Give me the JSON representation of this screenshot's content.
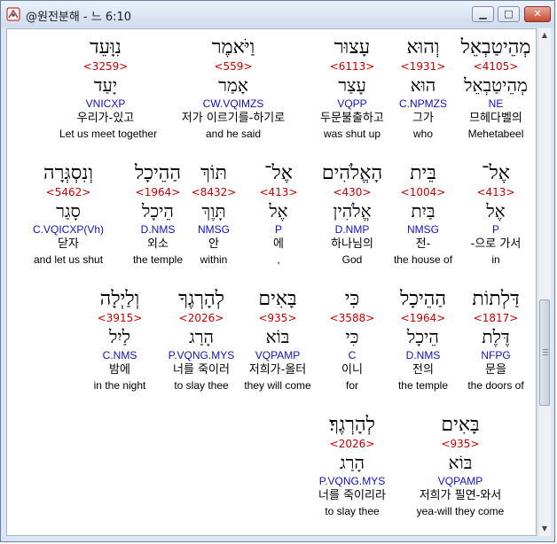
{
  "window": {
    "title": "@원전분해 - 느 6:10",
    "buttons": {
      "minimize": "▁",
      "maximize": "□",
      "close": "✕"
    }
  },
  "rows": [
    [
      {
        "hebrew": "מְהֵיטַבְאֵל",
        "number": "<4105>",
        "lexeme": "מְהֵיטַבְאֵל",
        "parse": "NE",
        "korean": "므헤다벨의",
        "english": "Mehetabeel"
      },
      {
        "hebrew": "וְהוּא",
        "number": "<1931>",
        "lexeme": "הוּא",
        "parse": "C.NPMZS",
        "korean": "그가",
        "english": "who"
      },
      {
        "hebrew": "עָצוּר",
        "number": "<6113>",
        "lexeme": "עָצַר",
        "parse": "VQPP",
        "korean": "두문불출하고",
        "english": "was shut up"
      },
      {
        "hebrew": "וַיֹּאמֶר",
        "number": "<559>",
        "lexeme": "אָמַר",
        "parse": "CW.VQIMZS",
        "korean": "저가 이르기를-하기로",
        "english": "and he said"
      },
      {
        "hebrew": "נִוָּעֵד",
        "number": "<3259>",
        "lexeme": "יָעַד",
        "parse": "VNICXP",
        "korean": "우리가-있고",
        "english": "Let us meet together"
      }
    ],
    [
      {
        "hebrew": "אֶל־",
        "number": "<413>",
        "lexeme": "אֶל",
        "parse": "P",
        "korean": "-으로 가서",
        "english": "in"
      },
      {
        "hebrew": "בֵּית",
        "number": "<1004>",
        "lexeme": "בַּיִת",
        "parse": "NMSG",
        "korean": "전-",
        "english": "the house of"
      },
      {
        "hebrew": "הָאֱלֹהִים",
        "number": "<430>",
        "lexeme": "אֱלֹהִין",
        "parse": "D.NMP",
        "korean": "하나님의",
        "english": "God"
      },
      {
        "hebrew": "אֶל־",
        "number": "<413>",
        "lexeme": "אֶל",
        "parse": "P",
        "korean": "에",
        "english": ","
      },
      {
        "hebrew": "תּוֹךְ",
        "number": "<8432>",
        "lexeme": "תָּוֶךְ",
        "parse": "NMSG",
        "korean": "안",
        "english": "within"
      },
      {
        "hebrew": "הַהֵיכָל",
        "number": "<1964>",
        "lexeme": "הֵיכָל",
        "parse": "D.NMS",
        "korean": "외소",
        "english": "the temple"
      },
      {
        "hebrew": "וְנִסְגְּרָה",
        "number": "<5462>",
        "lexeme": "סָגַר",
        "parse": "C.VQICXP(Vh)",
        "korean": "닫자",
        "english": "and let us shut"
      }
    ],
    [
      {
        "hebrew": "דַּלְתוֹת",
        "number": "<1817>",
        "lexeme": "דֶּלֶת",
        "parse": "NFPG",
        "korean": "문을",
        "english": "the doors of"
      },
      {
        "hebrew": "הַהֵיכָל",
        "number": "<1964>",
        "lexeme": "הֵיכָל",
        "parse": "D.NMS",
        "korean": "전의",
        "english": "the temple"
      },
      {
        "hebrew": "כִּי",
        "number": "<3588>",
        "lexeme": "כִּי",
        "parse": "C",
        "korean": "이니",
        "english": "for"
      },
      {
        "hebrew": "בָּאִים",
        "number": "<935>",
        "lexeme": "בּוֹא",
        "parse": "VQPAMP",
        "korean": "저희가-올터",
        "english": "they will come"
      },
      {
        "hebrew": "לְהָרְגֶךָ",
        "number": "<2026>",
        "lexeme": "הָרַג",
        "parse": "P.VQNG.MYS",
        "korean": "너를 죽이러",
        "english": "to slay thee"
      },
      {
        "hebrew": "וְלַיְלָה",
        "number": "<3915>",
        "lexeme": "לַיִל",
        "parse": "C.NMS",
        "korean": "밤에",
        "english": "in the night"
      }
    ],
    [
      {
        "hebrew": "בָּאִים",
        "number": "<935>",
        "lexeme": "בּוֹא",
        "parse": "VQPAMP",
        "korean": "저희가 필연-와서",
        "english": "yea-will they come"
      },
      {
        "hebrew": "לְהָרְגֶךָ׃",
        "number": "<2026>",
        "lexeme": "הָרַג",
        "parse": "P.VQNG.MYS",
        "korean": "너를 죽이리라",
        "english": "to slay thee"
      }
    ]
  ]
}
